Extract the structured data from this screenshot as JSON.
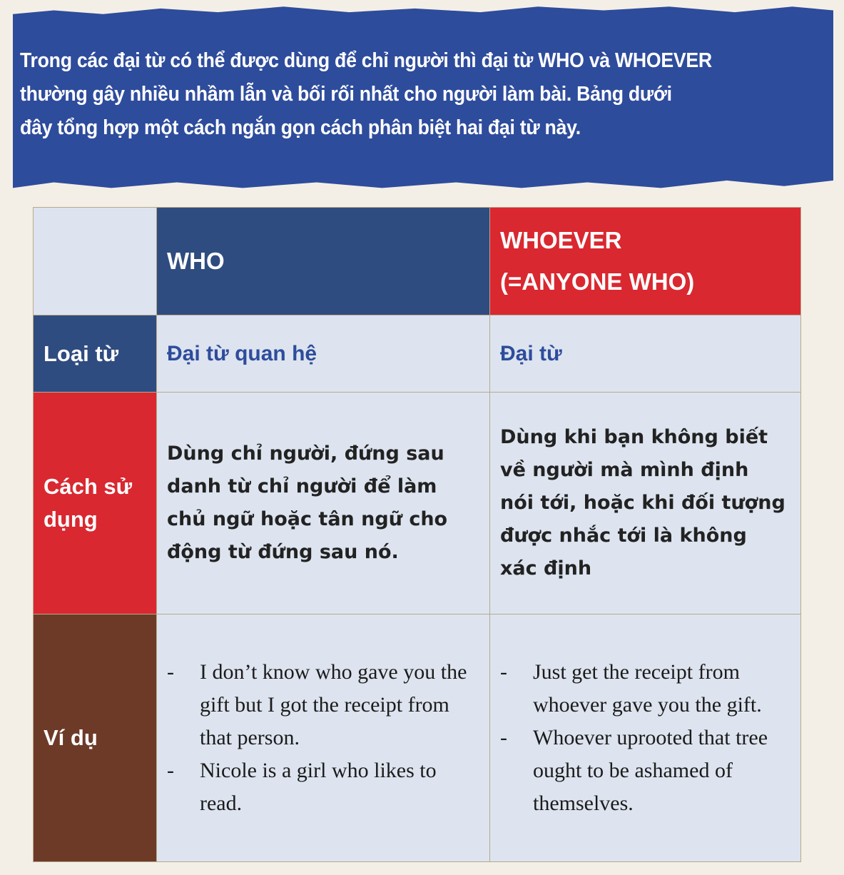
{
  "banner": {
    "lines": [
      "Trong các đại từ có thể được dùng để chỉ người thì đại từ WHO và WHOEVER",
      "thường gây nhiều nhầm lẫn và bối rối nhất cho người làm bài. Bảng dưới",
      "đây tổng hợp một cách ngắn gọn cách phân biệt hai đại từ này."
    ]
  },
  "table": {
    "header": {
      "who": "WHO",
      "whoever_line1": "WHOEVER",
      "whoever_line2": "(=ANYONE WHO)"
    },
    "rows": {
      "type": {
        "label": "Loại từ",
        "who": "Đại từ quan hệ",
        "whoever": "Đại từ"
      },
      "usage": {
        "label_line1": "Cách sử",
        "label_line2": "dụng",
        "who_lines": [
          "Dùng chỉ người, đứng sau",
          "danh từ chỉ người để làm",
          "chủ ngữ hoặc tân ngữ cho",
          "động từ đứng sau nó."
        ],
        "whoever_lines": [
          "Dùng khi bạn không biết",
          "về người mà mình định",
          "nói tới, hoặc khi đối tượng",
          "được nhắc tới là không",
          "xác định"
        ]
      },
      "example": {
        "label": "Ví dụ",
        "who_items": [
          "I don’t know who gave you the gift but I got the receipt from that person.",
          "Nicole is a girl who likes to read."
        ],
        "whoever_items": [
          "Just get the receipt from whoever gave you the gift.",
          "Whoever uprooted that tree ought to be ashamed of themselves."
        ]
      }
    }
  },
  "colors": {
    "navy": "#2f4c80",
    "red": "#d92830",
    "brown": "#6e3a28",
    "banner_blue": "#2e4c9c",
    "cell_bg": "#dde4ef"
  }
}
